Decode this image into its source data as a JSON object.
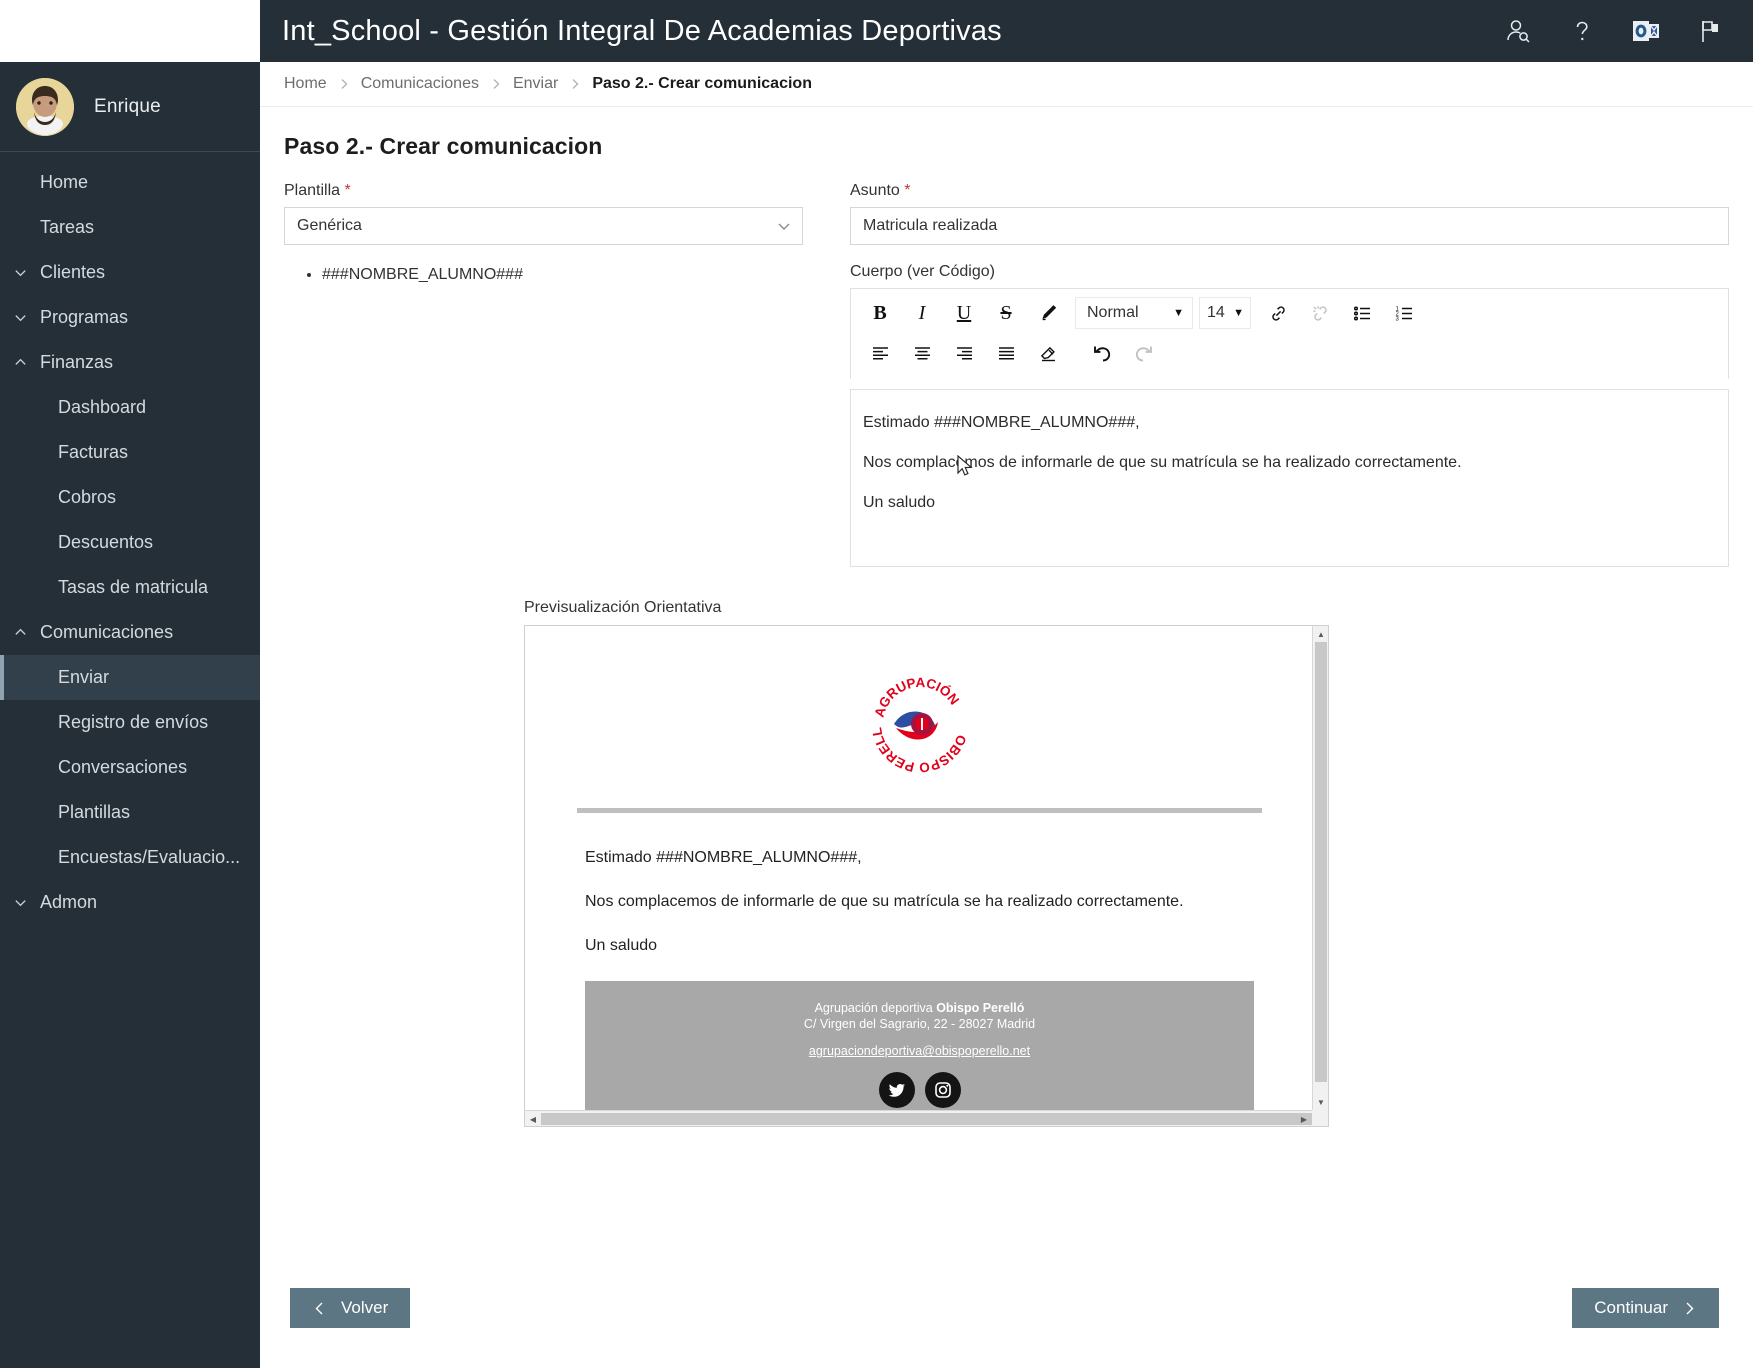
{
  "app": {
    "title": "Int_School - Gestión Integral De Academias Deportivas",
    "accent": "#242f38",
    "button_color": "#5d7683"
  },
  "topbar_icons": [
    {
      "name": "user-search-icon",
      "label": "Buscar usuario"
    },
    {
      "name": "help-icon",
      "label": "Ayuda"
    },
    {
      "name": "outlook-icon",
      "label": "Outlook"
    },
    {
      "name": "flag-icon",
      "label": "Avisos"
    }
  ],
  "sidebar": {
    "user": {
      "name": "Enrique"
    },
    "items": [
      {
        "label": "Home",
        "level": 0,
        "chevron": "none",
        "active": false
      },
      {
        "label": "Tareas",
        "level": 0,
        "chevron": "none",
        "active": false
      },
      {
        "label": "Clientes",
        "level": 0,
        "chevron": "down",
        "active": false
      },
      {
        "label": "Programas",
        "level": 0,
        "chevron": "down",
        "active": false
      },
      {
        "label": "Finanzas",
        "level": 0,
        "chevron": "up",
        "active": false
      },
      {
        "label": "Dashboard",
        "level": 1,
        "chevron": "none",
        "active": false
      },
      {
        "label": "Facturas",
        "level": 1,
        "chevron": "none",
        "active": false
      },
      {
        "label": "Cobros",
        "level": 1,
        "chevron": "none",
        "active": false
      },
      {
        "label": "Descuentos",
        "level": 1,
        "chevron": "none",
        "active": false
      },
      {
        "label": "Tasas de matricula",
        "level": 1,
        "chevron": "none",
        "active": false
      },
      {
        "label": "Comunicaciones",
        "level": 0,
        "chevron": "up",
        "active": false
      },
      {
        "label": "Enviar",
        "level": 1,
        "chevron": "none",
        "active": true
      },
      {
        "label": "Registro de envíos",
        "level": 1,
        "chevron": "none",
        "active": false
      },
      {
        "label": "Conversaciones",
        "level": 1,
        "chevron": "none",
        "active": false
      },
      {
        "label": "Plantillas",
        "level": 1,
        "chevron": "none",
        "active": false
      },
      {
        "label": "Encuestas/Evaluacio...",
        "level": 1,
        "chevron": "none",
        "active": false
      },
      {
        "label": "Admon",
        "level": 0,
        "chevron": "down",
        "active": false
      }
    ]
  },
  "breadcrumb": [
    {
      "label": "Home",
      "current": false
    },
    {
      "label": "Comunicaciones",
      "current": false
    },
    {
      "label": "Enviar",
      "current": false
    },
    {
      "label": "Paso 2.- Crear comunicacion",
      "current": true
    }
  ],
  "page": {
    "title": "Paso 2.- Crear comunicacion"
  },
  "form": {
    "plantilla": {
      "label": "Plantilla",
      "required": "*",
      "value": "Genérica",
      "tokens": [
        "###NOMBRE_ALUMNO###"
      ]
    },
    "asunto": {
      "label": "Asunto",
      "required": "*",
      "value": "Matricula realizada",
      "placeholder": ""
    },
    "cuerpo": {
      "label": "Cuerpo (ver Código)",
      "format_value": "Normal",
      "size_value": "14",
      "paragraphs": [
        "Estimado ###NOMBRE_ALUMNO###,",
        "Nos complacemos de informarle de que su matrícula se ha realizado correctamente.",
        "Un saludo"
      ]
    }
  },
  "toolbar": {
    "row1": [
      {
        "name": "bold-button",
        "glyph": "B",
        "disabled": false
      },
      {
        "name": "italic-button",
        "glyph": "I",
        "disabled": false
      },
      {
        "name": "underline-button",
        "glyph": "U",
        "disabled": false
      },
      {
        "name": "strikethrough-button",
        "glyph": "S",
        "disabled": false
      },
      {
        "name": "text-color-button",
        "glyph": "pen",
        "disabled": false
      }
    ],
    "row1b": [
      {
        "name": "link-button",
        "glyph": "link",
        "disabled": false
      },
      {
        "name": "unlink-button",
        "glyph": "unlink",
        "disabled": true
      },
      {
        "name": "bullet-list-button",
        "glyph": "ul",
        "disabled": false
      },
      {
        "name": "numbered-list-button",
        "glyph": "ol",
        "disabled": false
      }
    ],
    "row2": [
      {
        "name": "align-left-button",
        "glyph": "al",
        "disabled": false
      },
      {
        "name": "align-center-button",
        "glyph": "ac",
        "disabled": false
      },
      {
        "name": "align-right-button",
        "glyph": "ar",
        "disabled": false
      },
      {
        "name": "align-justify-button",
        "glyph": "aj",
        "disabled": false
      },
      {
        "name": "clear-format-button",
        "glyph": "eraser",
        "disabled": false
      },
      {
        "name": "undo-button",
        "glyph": "undo",
        "disabled": false
      },
      {
        "name": "redo-button",
        "glyph": "redo",
        "disabled": true
      }
    ]
  },
  "preview": {
    "label": "Previsualización Orientativa",
    "logo_alt": "Agrupación deportiva Obispo Perelló",
    "paragraphs": [
      "Estimado ###NOMBRE_ALUMNO###,",
      "Nos complacemos de informarle de que su matrícula se ha realizado correctamente.",
      "Un saludo"
    ],
    "footer": {
      "org_prefix": "Agrupación deportiva ",
      "org_name": "Obispo Perelló",
      "address": "C/ Virgen del Sagrario, 22 - 28027 Madrid",
      "email": "agrupaciondeportiva@obispoperello.net",
      "social": [
        "twitter-icon",
        "instagram-icon"
      ]
    }
  },
  "actions": {
    "back_label": "Volver",
    "next_label": "Continuar"
  }
}
